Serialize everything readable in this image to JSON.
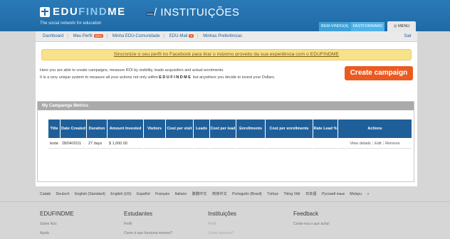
{
  "header": {
    "logo_edu": "EDU",
    "logo_find": "FIND",
    "logo_me": "ME",
    "logo_beta": "beta",
    "page_title": "/ INSTITUIÇÕES",
    "tagline": "The social network for education",
    "welcome": "BEM-VINDO(A)",
    "welcome_user": "FASTFORWARD",
    "menu_label": "MENU"
  },
  "nav": {
    "items": [
      "Dashboard",
      "Meu Perfil",
      "Minha EDU-Comunidade",
      "EDU-Mail",
      "Minhas Preferências"
    ],
    "perfil_badge": "24%",
    "mail_badge": "0",
    "logout": "Sair"
  },
  "facebook_bar": "Sincronize o seu perfil no Facebook para tirar o máximo proveito da sua experiência com o EDUFINDME",
  "intro": {
    "line1": "Here you are able to create campaigns, measure ROI by visibility, leads acquisition and actual enrolments.",
    "line2_a": "It is a very unique system to measure all your actions not only within",
    "line2_brand": "EDUFINDME",
    "line2_b": "but anywhere you decide to invest your Dollars."
  },
  "cta_label": "Create campaign",
  "metrics": {
    "title": "My Campaings Metrics",
    "columns": [
      "Title",
      "Date Created",
      "Duration",
      "Amount Invested",
      "Visitors",
      "Cost per visit",
      "Leads",
      "Cost per lead",
      "Enrollments",
      "Cost per enrollments",
      "Rate Lead %",
      "Actions"
    ],
    "rows": [
      {
        "title": "teste",
        "date": "28/04/2011",
        "duration": "27 days",
        "amount": "$ 1,000.00",
        "visitors": "",
        "cost_visit": "",
        "leads": "",
        "cost_lead": "",
        "enrollments": "",
        "cost_enroll": "",
        "rate": "",
        "actions": [
          "View details",
          "Edit",
          "Remove"
        ]
      }
    ]
  },
  "languages": [
    "Català",
    "Deutsch",
    "English (Standard)",
    "English (US)",
    "Español",
    "Français",
    "Italiano",
    "繁體中文",
    "简体中文",
    "Português (Brasil)",
    "Türkçe",
    "Tiếng Việt",
    "日本語",
    "Русский язык",
    "Melayu",
    "»"
  ],
  "footer": {
    "col1": {
      "title": "EDUFINDME",
      "links": [
        "Sobre Nós",
        "Ajuda"
      ]
    },
    "col2": {
      "title": "Estudantes",
      "links": [
        "Perfil",
        "Como é que funciona mesmo?"
      ]
    },
    "col3": {
      "title": "Instituições",
      "links": [
        "Perfil",
        "Como funciona?"
      ]
    },
    "col4": {
      "title": "Feedback",
      "links": [
        "Conte-nos o que acha!"
      ]
    }
  }
}
